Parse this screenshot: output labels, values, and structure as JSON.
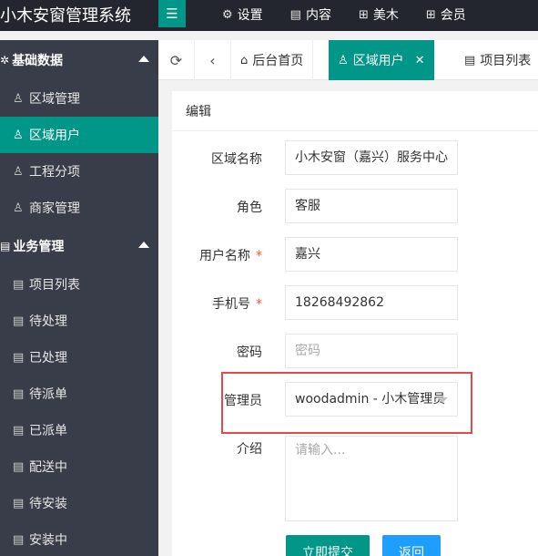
{
  "app": {
    "title": "小木安窗管理系统"
  },
  "topnav": [
    {
      "icon": "gear-icon",
      "glyph": "⚙",
      "label": "设置"
    },
    {
      "icon": "document-icon",
      "glyph": "▤",
      "label": "内容"
    },
    {
      "icon": "grid-icon",
      "glyph": "⊞",
      "label": "美木"
    },
    {
      "icon": "grid-icon",
      "glyph": "⊞",
      "label": "会员"
    }
  ],
  "sidebar": {
    "groups": [
      {
        "label": "基础数据",
        "items": [
          "区域管理",
          "区域用户",
          "工程分项",
          "商家管理"
        ]
      },
      {
        "label": "业务管理",
        "items": [
          "项目列表",
          "待处理",
          "已处理",
          "待派单",
          "已派单",
          "配送中",
          "待安装",
          "安装中"
        ]
      }
    ],
    "active": "区域用户"
  },
  "tabs": [
    {
      "icon": "home-icon",
      "label": "后台首页",
      "active": false
    },
    {
      "icon": "user-icon",
      "label": "区域用户",
      "active": true
    },
    {
      "icon": "document-icon",
      "label": "项目列表",
      "active": false
    }
  ],
  "form": {
    "heading": "编辑",
    "fields": {
      "region": {
        "label": "区域名称",
        "value": "小木安窗（嘉兴）服务中心"
      },
      "role": {
        "label": "角色",
        "value": "客服"
      },
      "username": {
        "label": "用户名称",
        "required": "*",
        "value": "嘉兴"
      },
      "phone": {
        "label": "手机号",
        "required": "*",
        "value": "18268492862"
      },
      "password": {
        "label": "密码",
        "placeholder": "密码"
      },
      "admin": {
        "label": "管理员",
        "value": "woodadmin - 小木管理员"
      },
      "intro": {
        "label": "介绍",
        "placeholder": "请输入..."
      }
    },
    "submit_label": "立即提交",
    "back_label": "返回"
  },
  "colors": {
    "accent": "#009688",
    "sidebar": "#393d49",
    "topbar": "#23262e",
    "highlight": "#e34a4a",
    "blue": "#1e9fff"
  }
}
